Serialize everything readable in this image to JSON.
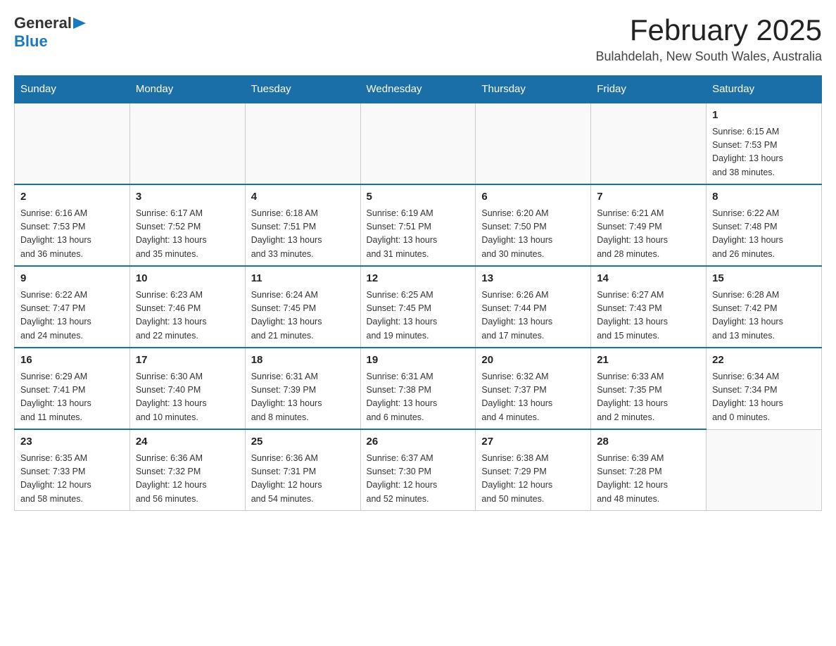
{
  "header": {
    "logo": {
      "text_general": "General",
      "triangle": "▶",
      "text_blue": "Blue"
    },
    "title": "February 2025",
    "location": "Bulahdelah, New South Wales, Australia"
  },
  "days_of_week": [
    "Sunday",
    "Monday",
    "Tuesday",
    "Wednesday",
    "Thursday",
    "Friday",
    "Saturday"
  ],
  "weeks": [
    {
      "days": [
        {
          "num": "",
          "info": ""
        },
        {
          "num": "",
          "info": ""
        },
        {
          "num": "",
          "info": ""
        },
        {
          "num": "",
          "info": ""
        },
        {
          "num": "",
          "info": ""
        },
        {
          "num": "",
          "info": ""
        },
        {
          "num": "1",
          "info": "Sunrise: 6:15 AM\nSunset: 7:53 PM\nDaylight: 13 hours\nand 38 minutes."
        }
      ]
    },
    {
      "days": [
        {
          "num": "2",
          "info": "Sunrise: 6:16 AM\nSunset: 7:53 PM\nDaylight: 13 hours\nand 36 minutes."
        },
        {
          "num": "3",
          "info": "Sunrise: 6:17 AM\nSunset: 7:52 PM\nDaylight: 13 hours\nand 35 minutes."
        },
        {
          "num": "4",
          "info": "Sunrise: 6:18 AM\nSunset: 7:51 PM\nDaylight: 13 hours\nand 33 minutes."
        },
        {
          "num": "5",
          "info": "Sunrise: 6:19 AM\nSunset: 7:51 PM\nDaylight: 13 hours\nand 31 minutes."
        },
        {
          "num": "6",
          "info": "Sunrise: 6:20 AM\nSunset: 7:50 PM\nDaylight: 13 hours\nand 30 minutes."
        },
        {
          "num": "7",
          "info": "Sunrise: 6:21 AM\nSunset: 7:49 PM\nDaylight: 13 hours\nand 28 minutes."
        },
        {
          "num": "8",
          "info": "Sunrise: 6:22 AM\nSunset: 7:48 PM\nDaylight: 13 hours\nand 26 minutes."
        }
      ]
    },
    {
      "days": [
        {
          "num": "9",
          "info": "Sunrise: 6:22 AM\nSunset: 7:47 PM\nDaylight: 13 hours\nand 24 minutes."
        },
        {
          "num": "10",
          "info": "Sunrise: 6:23 AM\nSunset: 7:46 PM\nDaylight: 13 hours\nand 22 minutes."
        },
        {
          "num": "11",
          "info": "Sunrise: 6:24 AM\nSunset: 7:45 PM\nDaylight: 13 hours\nand 21 minutes."
        },
        {
          "num": "12",
          "info": "Sunrise: 6:25 AM\nSunset: 7:45 PM\nDaylight: 13 hours\nand 19 minutes."
        },
        {
          "num": "13",
          "info": "Sunrise: 6:26 AM\nSunset: 7:44 PM\nDaylight: 13 hours\nand 17 minutes."
        },
        {
          "num": "14",
          "info": "Sunrise: 6:27 AM\nSunset: 7:43 PM\nDaylight: 13 hours\nand 15 minutes."
        },
        {
          "num": "15",
          "info": "Sunrise: 6:28 AM\nSunset: 7:42 PM\nDaylight: 13 hours\nand 13 minutes."
        }
      ]
    },
    {
      "days": [
        {
          "num": "16",
          "info": "Sunrise: 6:29 AM\nSunset: 7:41 PM\nDaylight: 13 hours\nand 11 minutes."
        },
        {
          "num": "17",
          "info": "Sunrise: 6:30 AM\nSunset: 7:40 PM\nDaylight: 13 hours\nand 10 minutes."
        },
        {
          "num": "18",
          "info": "Sunrise: 6:31 AM\nSunset: 7:39 PM\nDaylight: 13 hours\nand 8 minutes."
        },
        {
          "num": "19",
          "info": "Sunrise: 6:31 AM\nSunset: 7:38 PM\nDaylight: 13 hours\nand 6 minutes."
        },
        {
          "num": "20",
          "info": "Sunrise: 6:32 AM\nSunset: 7:37 PM\nDaylight: 13 hours\nand 4 minutes."
        },
        {
          "num": "21",
          "info": "Sunrise: 6:33 AM\nSunset: 7:35 PM\nDaylight: 13 hours\nand 2 minutes."
        },
        {
          "num": "22",
          "info": "Sunrise: 6:34 AM\nSunset: 7:34 PM\nDaylight: 13 hours\nand 0 minutes."
        }
      ]
    },
    {
      "days": [
        {
          "num": "23",
          "info": "Sunrise: 6:35 AM\nSunset: 7:33 PM\nDaylight: 12 hours\nand 58 minutes."
        },
        {
          "num": "24",
          "info": "Sunrise: 6:36 AM\nSunset: 7:32 PM\nDaylight: 12 hours\nand 56 minutes."
        },
        {
          "num": "25",
          "info": "Sunrise: 6:36 AM\nSunset: 7:31 PM\nDaylight: 12 hours\nand 54 minutes."
        },
        {
          "num": "26",
          "info": "Sunrise: 6:37 AM\nSunset: 7:30 PM\nDaylight: 12 hours\nand 52 minutes."
        },
        {
          "num": "27",
          "info": "Sunrise: 6:38 AM\nSunset: 7:29 PM\nDaylight: 12 hours\nand 50 minutes."
        },
        {
          "num": "28",
          "info": "Sunrise: 6:39 AM\nSunset: 7:28 PM\nDaylight: 12 hours\nand 48 minutes."
        },
        {
          "num": "",
          "info": ""
        }
      ]
    }
  ]
}
